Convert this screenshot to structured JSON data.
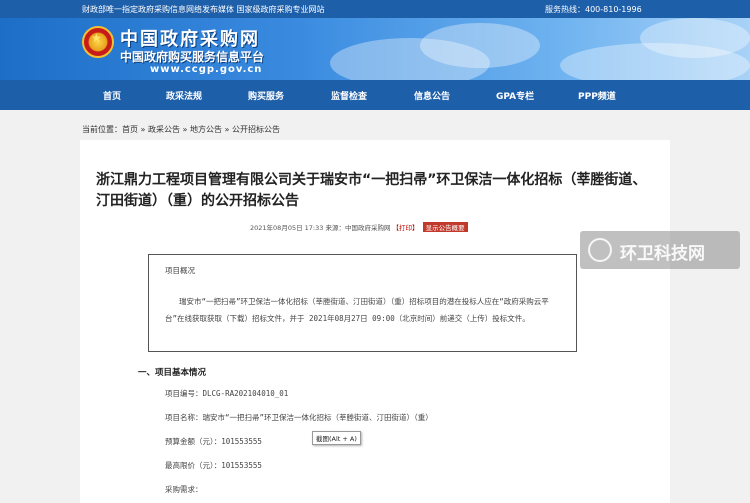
{
  "topbar": {
    "left_text": "财政部唯一指定政府采购信息网络发布媒体  国家级政府采购专业网站",
    "hotline": "服务热线：400-810-1996"
  },
  "header": {
    "brand_line1": "中国政府采购网",
    "brand_line2": "中国政府购买服务信息平台",
    "url": "www.ccgp.gov.cn"
  },
  "nav": {
    "items": [
      "首页",
      "政采法规",
      "购买服务",
      "监督检查",
      "信息公告",
      "GPA专栏",
      "PPP频道"
    ]
  },
  "breadcrumb": {
    "prefix": "当前位置：",
    "items": [
      "首页",
      "政采公告",
      "地方公告",
      "公开招标公告"
    ],
    "sep": " » "
  },
  "article": {
    "title": "浙江鼎力工程项目管理有限公司关于瑞安市“一把扫帚”环卫保洁一体化招标（莘塍街道、汀田街道）（重）的公开招标公告",
    "meta_date": "2021年08月05日 17:33",
    "meta_source": "来源：中国政府采购网",
    "meta_print": "【打印】",
    "meta_badge": "显示公告概要",
    "overview_heading": "项目概况",
    "overview_text": "瑞安市“一把扫帚”环卫保洁一体化招标（莘塍街道、汀田街道）（重）招标项目的潜在投标人应在“政府采购云平台”在线获取获取（下载）招标文件，并于 2021年08月27日 09:00（北京时间）前递交（上传）投标文件。",
    "section1_title": "一、项目基本情况",
    "lines": [
      "项目编号：DLCG-RA202104010_01",
      "项目名称：瑞安市“一把扫帚”环卫保洁一体化招标（莘塍街道、汀田街道）（重）",
      "预算金额（元）：101553555",
      "最高限价（元）：101553555",
      "采购需求："
    ]
  },
  "tooltip": "截图(Alt + A)",
  "watermark": "环卫科技网",
  "colors": {
    "nav_blue": "#1e5faa",
    "badge_red": "#c0392b"
  }
}
